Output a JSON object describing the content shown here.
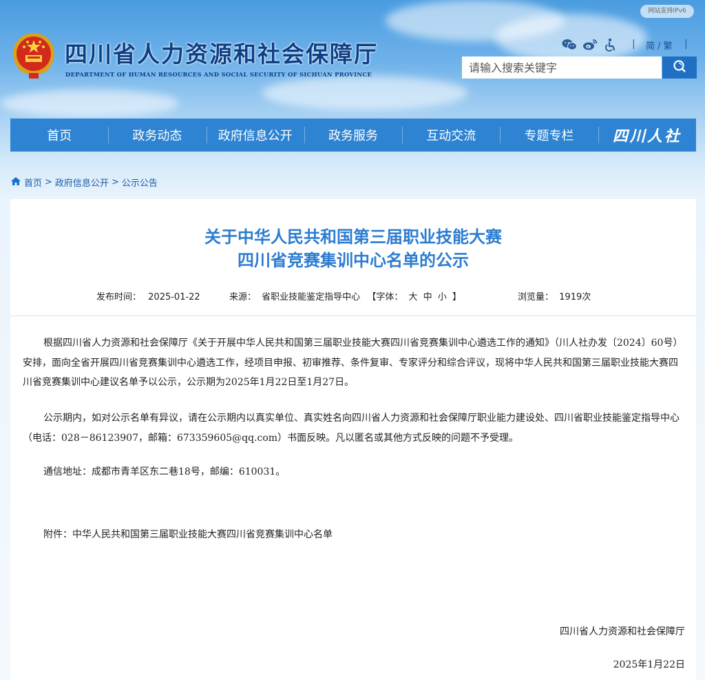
{
  "header": {
    "site_title": "四川省人力资源和社会保障厅",
    "site_subtitle": "DEPARTMENT OF HUMAN RESOURCES AND SOCIAL SECURITY OF SICHUAN PROVINCE",
    "ipv6_badge": "网站支持IPv6",
    "lang_simplified": "简",
    "lang_sep": "/",
    "lang_traditional": "繁",
    "search_placeholder": "请输入搜索关键字",
    "icons": [
      "wechat-icon",
      "weibo-icon",
      "accessibility-icon",
      "search-icon"
    ]
  },
  "nav": {
    "items": [
      "首页",
      "政务动态",
      "政府信息公开",
      "政务服务",
      "互动交流",
      "专题专栏"
    ],
    "logo_text": "四川人社"
  },
  "breadcrumb": {
    "home": "首页",
    "sep": ">",
    "level1": "政府信息公开",
    "level2": "公示公告"
  },
  "article": {
    "title_line1": "关于中华人民共和国第三届职业技能大赛",
    "title_line2": "四川省竞赛集训中心名单的公示",
    "publish_label": "发布时间：",
    "publish_date": "2025-01-22",
    "source_label": "来源：",
    "source": "省职业技能鉴定指导中心",
    "font_label_open": "【字体：",
    "font_large": "大",
    "font_medium": "中",
    "font_small": "小",
    "font_label_close": "】",
    "views_label": "浏览量：",
    "views": "1919次",
    "paragraph1": "根据四川省人力资源和社会保障厅《关于开展中华人民共和国第三届职业技能大赛四川省竞赛集训中心遴选工作的通知》（川人社办发〔2024〕60号）安排，面向全省开展四川省竞赛集训中心遴选工作，经项目申报、初审推荐、条件复审、专家评分和综合评议，现将中华人民共和国第三届职业技能大赛四川省竞赛集训中心建议名单予以公示，公示期为2025年1月22日至1月27日。",
    "paragraph2": "公示期内，如对公示名单有异议，请在公示期内以真实单位、真实姓名向四川省人力资源和社会保障厅职业能力建设处、四川省职业技能鉴定指导中心（电话：028－86123907，邮箱：673359605@qq.com）书面反映。凡以匿名或其他方式反映的问题不予受理。",
    "address": "通信地址：成都市青羊区东二巷18号，邮编：610031。",
    "attachment": "附件：中华人民共和国第三届职业技能大赛四川省竞赛集训中心名单",
    "signature_org": "四川省人力资源和社会保障厅",
    "signature_date": "2025年1月22日"
  },
  "colors": {
    "nav_bg": "#2e84d3",
    "title_blue": "#2b7cd0",
    "site_title": "#0d3f86",
    "search_button": "#1f6fc4"
  }
}
